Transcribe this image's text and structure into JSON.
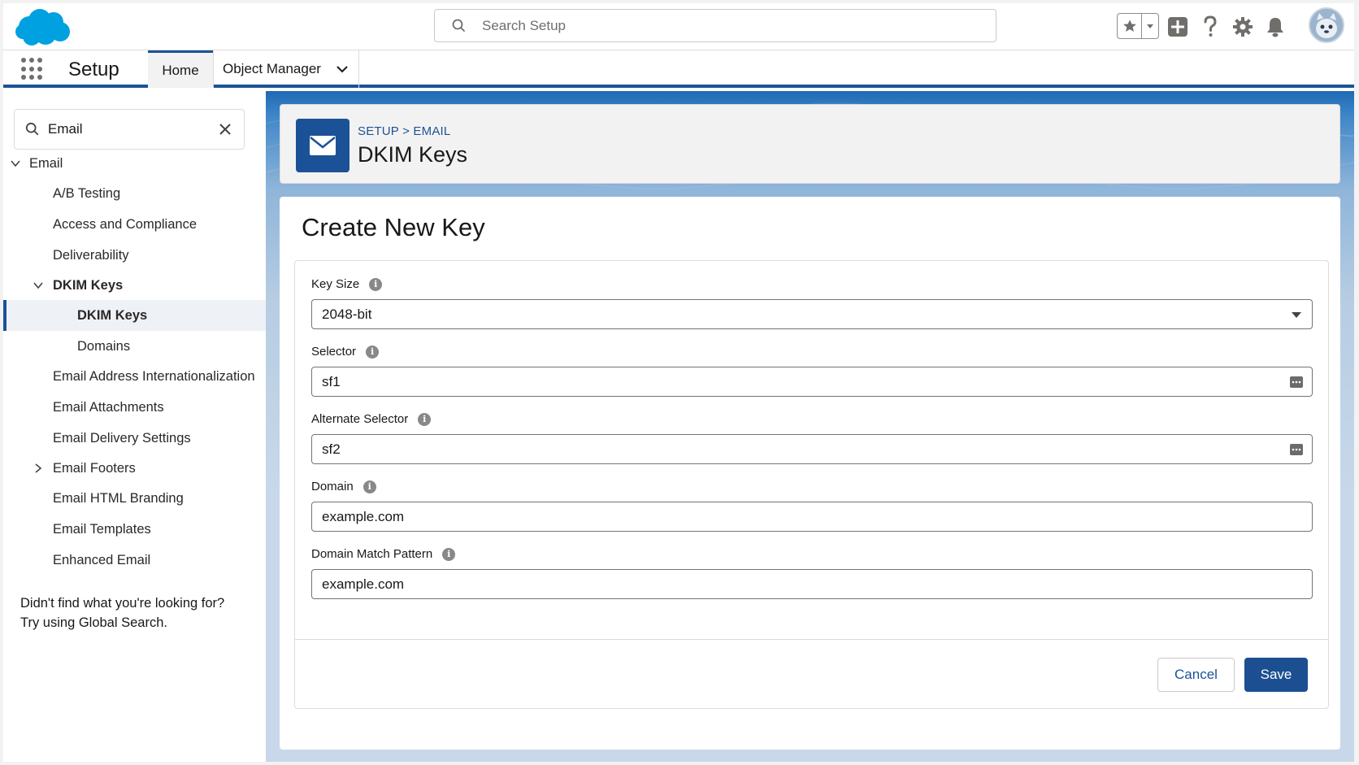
{
  "header": {
    "search_placeholder": "Search Setup",
    "icons": [
      "favorites-star-icon",
      "chevron-down-icon",
      "global-add-icon",
      "help-icon",
      "setup-gear-icon",
      "notification-bell-icon",
      "user-avatar"
    ]
  },
  "nav": {
    "app_name": "Setup",
    "tabs": [
      {
        "label": "Home",
        "active": true
      },
      {
        "label": "Object Manager",
        "has_menu": true
      }
    ]
  },
  "sidebar": {
    "quick_find_value": "Email",
    "items": [
      {
        "label": "Email",
        "level": 0,
        "expanded": true
      },
      {
        "label": "A/B Testing",
        "level": 1
      },
      {
        "label": "Access and Compliance",
        "level": 1
      },
      {
        "label": "Deliverability",
        "level": 1
      },
      {
        "label": "DKIM Keys",
        "level": 1,
        "expanded": true
      },
      {
        "label": "DKIM Keys",
        "level": 2,
        "selected": true
      },
      {
        "label": "Domains",
        "level": 2
      },
      {
        "label": "Email Address Internationalization",
        "level": 1
      },
      {
        "label": "Email Attachments",
        "level": 1
      },
      {
        "label": "Email Delivery Settings",
        "level": 1
      },
      {
        "label": "Email Footers",
        "level": 1,
        "collapsed": true
      },
      {
        "label": "Email HTML Branding",
        "level": 1
      },
      {
        "label": "Email Templates",
        "level": 1
      },
      {
        "label": "Enhanced Email",
        "level": 1
      }
    ],
    "help_line1": "Didn't find what you're looking for?",
    "help_line2": "Try using Global Search."
  },
  "page_header": {
    "breadcrumb": "SETUP > EMAIL",
    "title": "DKIM Keys",
    "icon": "email-envelope-icon"
  },
  "form": {
    "title": "Create New Key",
    "fields": [
      {
        "label": "Key Size",
        "value": "2048-bit",
        "type": "select"
      },
      {
        "label": "Selector",
        "value": "sf1",
        "type": "text-with-icon"
      },
      {
        "label": "Alternate Selector",
        "value": "sf2",
        "type": "text-with-icon"
      },
      {
        "label": "Domain",
        "value": "example.com",
        "type": "text"
      },
      {
        "label": "Domain Match Pattern",
        "value": "example.com",
        "type": "text"
      }
    ],
    "cancel_label": "Cancel",
    "save_label": "Save"
  },
  "colors": {
    "brand_blue": "#1b5297",
    "save_button": "#1b4f91",
    "cloud_logo": "#00a1e0"
  }
}
